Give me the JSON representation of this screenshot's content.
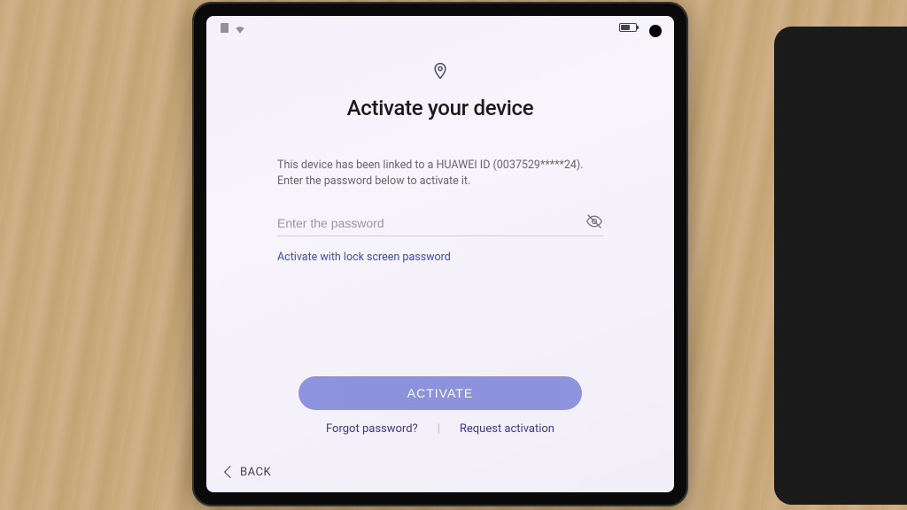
{
  "header": {
    "title": "Activate your device"
  },
  "instruction": {
    "line1": "This device has been linked to a HUAWEI ID (0037529*****24).",
    "line2": "Enter the password below to activate it."
  },
  "password_field": {
    "placeholder": "Enter the password",
    "value": ""
  },
  "alt_activate_link": "Activate with lock screen password",
  "activate_button": "ACTIVATE",
  "forgot_link": "Forgot password?",
  "request_link": "Request activation",
  "back_label": "BACK",
  "icons": {
    "location": "location-pin-icon",
    "eye_toggle": "eye-off-icon",
    "battery": "battery-icon",
    "sim": "sim-icon",
    "wifi": "wifi-icon",
    "chevron_left": "chevron-left-icon"
  }
}
